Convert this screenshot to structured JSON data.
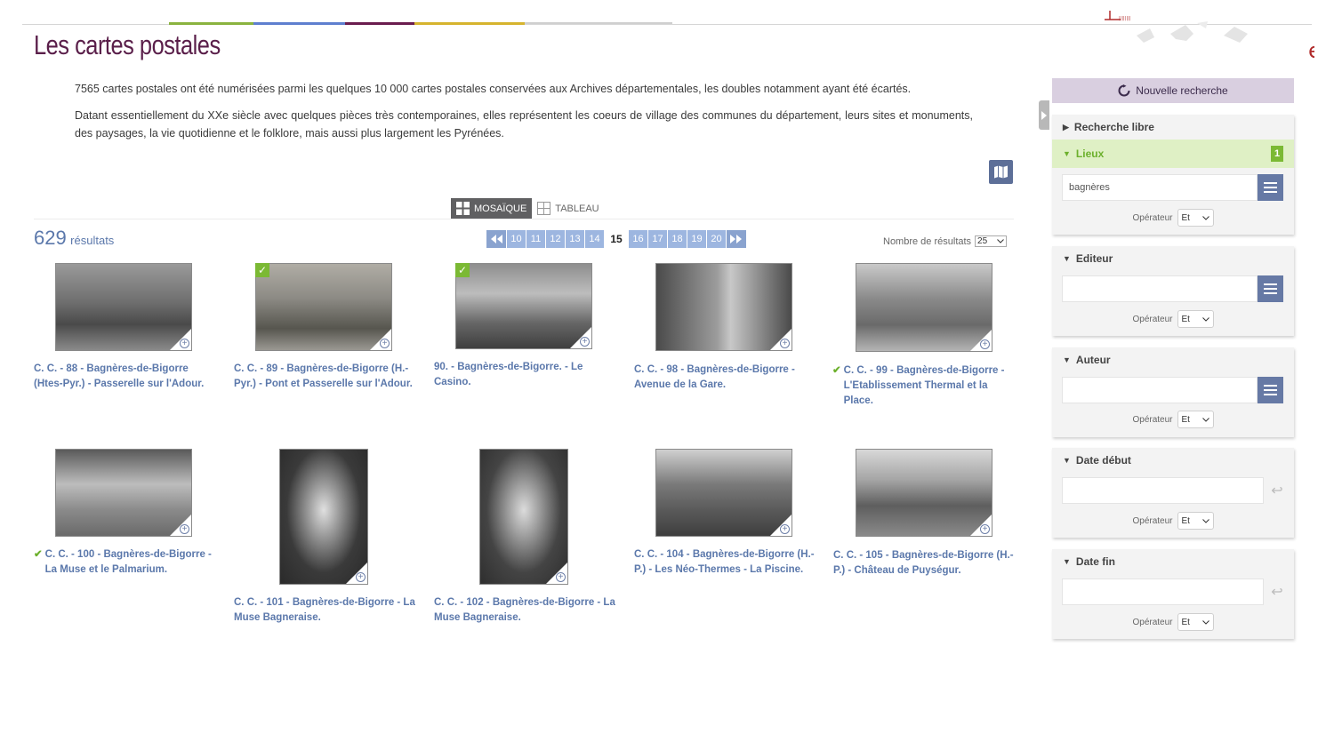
{
  "header": {
    "title": "Les cartes postales",
    "stripe_colors": [
      "#8ab33f",
      "#5e7fcf",
      "#6a1c4e",
      "#d6b42e",
      "#cfcfcf"
    ]
  },
  "intro": {
    "p1": "7565 cartes postales ont été numérisées parmi les quelques 10 000 cartes postales conservées aux Archives départementales, les doubles notamment ayant été écartés.",
    "p2": "Datant essentiellement du XXe siècle avec quelques pièces très contemporaines, elles représentent les coeurs de village des communes du département, leurs sites et monuments, des paysages, la vie quotidienne et le folklore, mais aussi plus largement les Pyrénées."
  },
  "view": {
    "mosaic_label": "MOSAÏQUE",
    "table_label": "TABLEAU"
  },
  "results": {
    "count": "629",
    "label": "résultats",
    "per_page_label": "Nombre de résultats",
    "per_page_value": "25"
  },
  "pagination": {
    "before": [
      "10",
      "11",
      "12",
      "13",
      "14"
    ],
    "current": "15",
    "after": [
      "16",
      "17",
      "18",
      "19",
      "20"
    ]
  },
  "cards": [
    {
      "caption": "C. C. - 88 - Bagnères-de-Bigorre (Htes-Pyr.) - Passerelle sur l'Adour.",
      "checked": false
    },
    {
      "caption": "C. C. - 89 - Bagnères-de-Bigorre (H.-Pyr.) - Pont et Passerelle sur l'Adour.",
      "checked": true
    },
    {
      "caption": "90. - Bagnères-de-Bigorre. - Le Casino.",
      "checked": true
    },
    {
      "caption": "C. C. - 98 - Bagnères-de-Bigorre - Avenue de la Gare.",
      "checked": false
    },
    {
      "caption": "C. C. - 99 - Bagnères-de-Bigorre - L'Etablissement Thermal et la Place.",
      "checked": true
    },
    {
      "caption": "C. C. - 100 - Bagnères-de-Bigorre - La Muse et le Palmarium.",
      "checked": true
    },
    {
      "caption": "C. C. - 101 - Bagnères-de-Bigorre - La Muse Bagneraise.",
      "checked": false
    },
    {
      "caption": "C. C. - 102 - Bagnères-de-Bigorre - La Muse Bagneraise.",
      "checked": false
    },
    {
      "caption": "C. C. - 104 - Bagnères-de-Bigorre (H.-P.) - Les Néo-Thermes - La Piscine.",
      "checked": false
    },
    {
      "caption": "C. C. - 105 - Bagnères-de-Bigorre (H.-P.) - Château de Puységur.",
      "checked": false
    }
  ],
  "sidebar": {
    "new_search": "Nouvelle recherche",
    "free_search": "Recherche libre",
    "places": {
      "title": "Lieux",
      "count": "1",
      "value": "bagnères"
    },
    "publisher": {
      "title": "Editeur",
      "value": ""
    },
    "author": {
      "title": "Auteur",
      "value": ""
    },
    "date_start": {
      "title": "Date début"
    },
    "date_end": {
      "title": "Date fin"
    },
    "operator_label": "Opérateur",
    "operator_value": "Et"
  }
}
